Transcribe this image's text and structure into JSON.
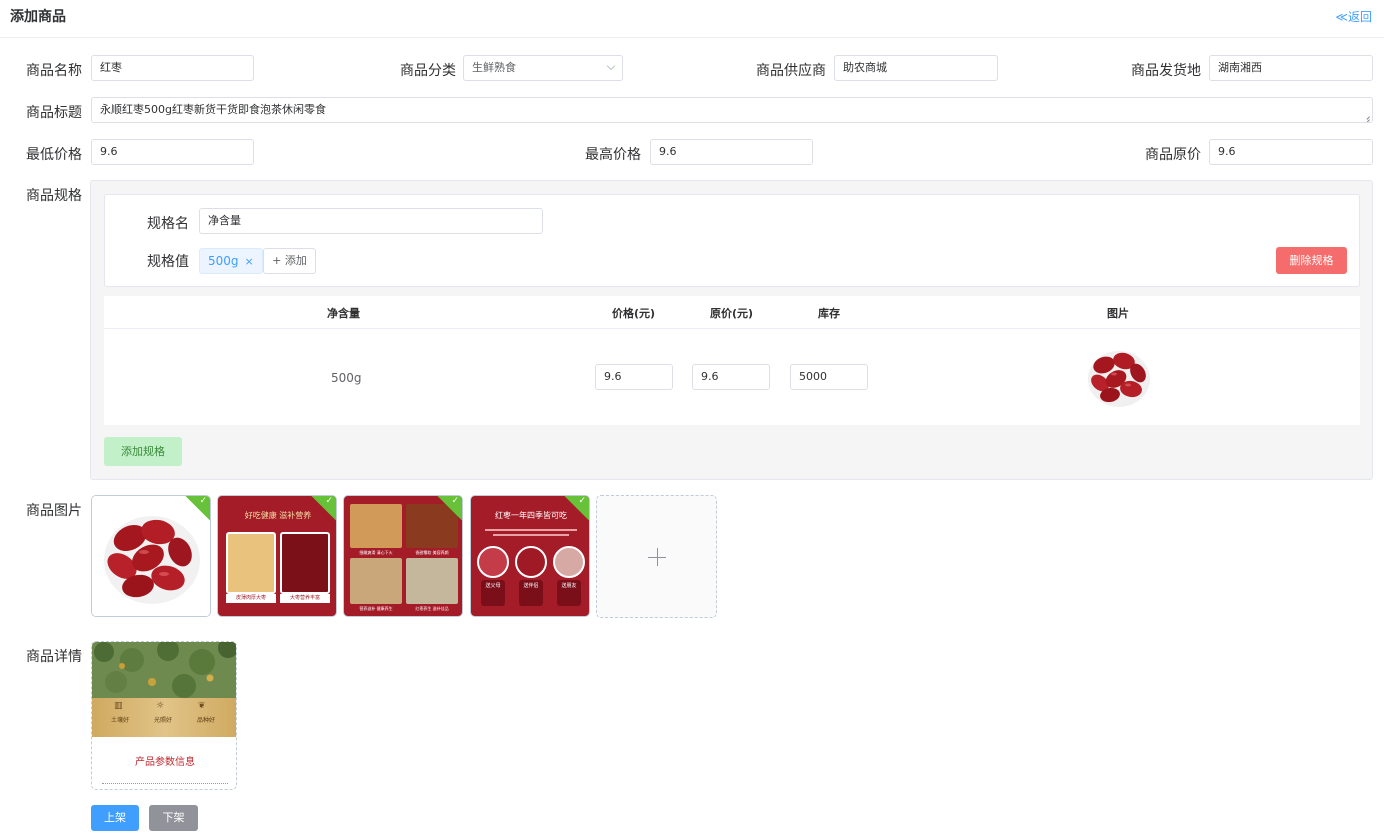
{
  "header": {
    "title": "添加商品",
    "back_label": "≪返回"
  },
  "form": {
    "name_label": "商品名称",
    "name_value": "红枣",
    "category_label": "商品分类",
    "category_value": "生鲜熟食",
    "supplier_label": "商品供应商",
    "supplier_value": "助农商城",
    "origin_label": "商品发货地",
    "origin_value": "湖南湘西",
    "title_label": "商品标题",
    "title_value": "永顺红枣500g红枣新货干货即食泡茶休闲零食",
    "min_price_label": "最低价格",
    "min_price_value": "9.6",
    "max_price_label": "最高价格",
    "max_price_value": "9.6",
    "orig_price_label": "商品原价",
    "orig_price_value": "9.6",
    "spec_label": "商品规格",
    "images_label": "商品图片",
    "detail_label": "商品详情"
  },
  "spec": {
    "name_label": "规格名",
    "name_value": "净含量",
    "value_label": "规格值",
    "tag_value": "500g",
    "tag_close": "×",
    "add_value_label": "+ 添加",
    "delete_label": "删除规格",
    "add_spec_label": "添加规格"
  },
  "sku": {
    "headers": {
      "spec": "净含量",
      "price": "价格(元)",
      "orig": "原价(元)",
      "stock": "库存",
      "image": "图片"
    },
    "row": {
      "spec": "500g",
      "price": "9.6",
      "orig": "9.6",
      "stock": "5000"
    }
  },
  "thumbs": {
    "t2_text_top": "好吃健康 滋补营养",
    "t2_c1": "皮薄肉厚大枣",
    "t2_c2": "大枣营养丰富",
    "t3_c1": "细嫩爽滑 清心下火",
    "t3_c2": "香甜糯软 美容养颜",
    "t3_c3": "营养滋补 健康养生",
    "t3_c4": "红枣养生 滋补佳品",
    "t4_title": "红枣一年四季皆可吃",
    "t4_b1": "送父母",
    "t4_b2": "送伴侣",
    "t4_b3": "送朋友"
  },
  "detail": {
    "col1": "土壤好",
    "col2": "光照好",
    "col3": "品种好",
    "heading": "产品参数信息"
  },
  "actions": {
    "publish": "上架",
    "unpublish": "下架"
  },
  "colors": {
    "primary": "#409eff",
    "danger": "#f56c6c",
    "success_light": "#c2f0c8",
    "gray": "#909399",
    "jujube_red": "#b4232a"
  }
}
